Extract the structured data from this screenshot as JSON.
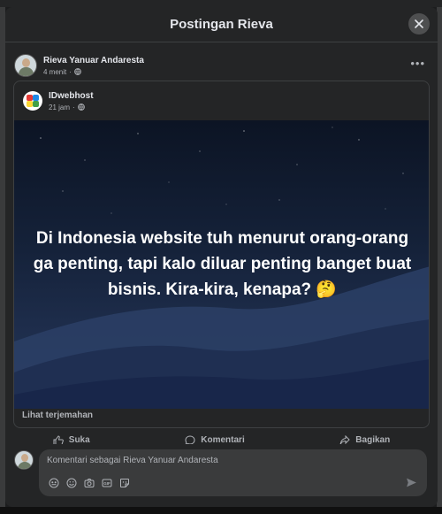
{
  "modal": {
    "title": "Postingan Rieva"
  },
  "post": {
    "author": "Rieva Yanuar Andaresta",
    "time": "4 menit",
    "separator": "·",
    "privacy_icon": "globe-icon"
  },
  "shared": {
    "page_name": "IDwebhost",
    "time": "21 jam",
    "separator": "·",
    "image_text": "Di Indonesia website tuh menurut orang-orang ga penting, tapi kalo diluar penting banget buat bisnis. Kira-kira, kenapa? 🤔",
    "translate_link": "Lihat terjemahan"
  },
  "actions": [
    {
      "label": "Suka",
      "icon": "like-icon"
    },
    {
      "label": "Komentari",
      "icon": "comment-icon"
    },
    {
      "label": "Bagikan",
      "icon": "share-icon"
    }
  ],
  "comment": {
    "placeholder": "Komentari sebagai Rieva Yanuar Andaresta",
    "tools": [
      "avatar-sticker-icon",
      "emoji-icon",
      "camera-icon",
      "gif-icon",
      "sticker-icon"
    ],
    "send_icon": "send-icon"
  },
  "colors": {
    "modal_bg": "#242526",
    "text_primary": "#e4e6eb",
    "text_secondary": "#b0b3b8",
    "comment_box": "#3a3b3c"
  }
}
